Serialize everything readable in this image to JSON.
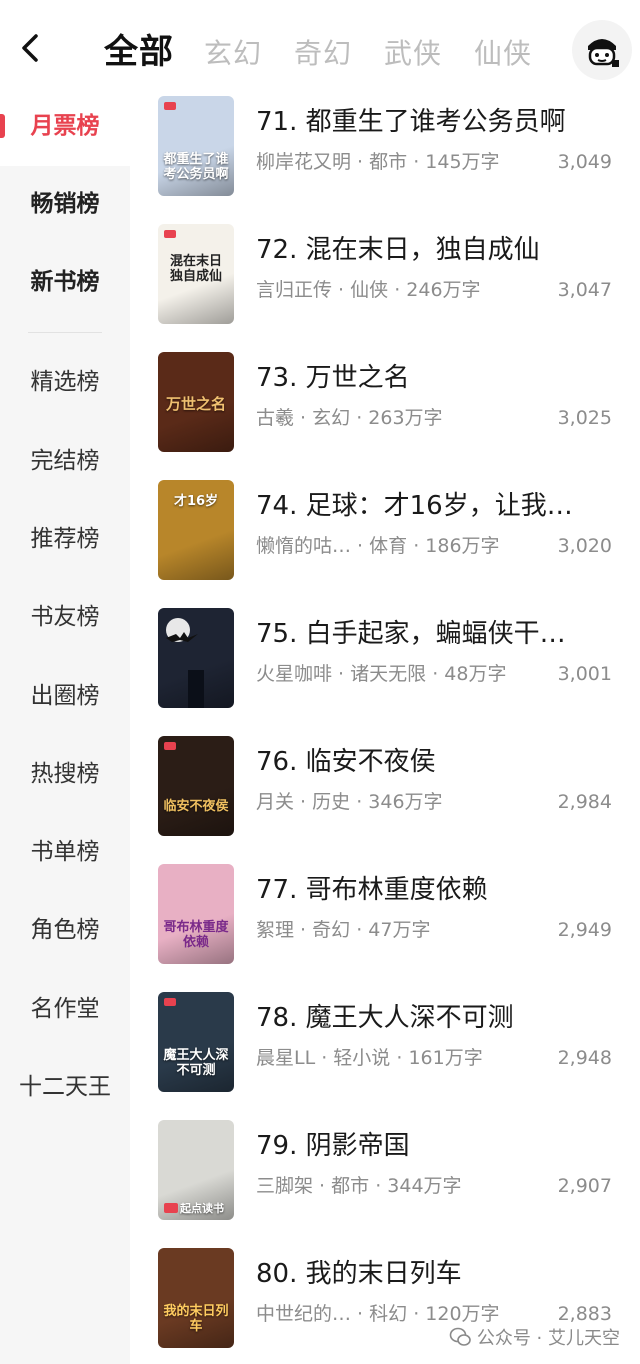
{
  "header": {
    "tabs": [
      {
        "label": "全部",
        "active": true
      },
      {
        "label": "玄幻"
      },
      {
        "label": "奇幻"
      },
      {
        "label": "武侠"
      },
      {
        "label": "仙侠"
      }
    ],
    "back_icon": "chevron-left-icon",
    "avatar_icon": "mascot-avatar-icon"
  },
  "sidebar": {
    "items": [
      {
        "label": "月票榜",
        "active": true
      },
      {
        "label": "畅销榜"
      },
      {
        "label": "新书榜"
      },
      {
        "label": "精选榜"
      },
      {
        "label": "完结榜"
      },
      {
        "label": "推荐榜"
      },
      {
        "label": "书友榜"
      },
      {
        "label": "出圈榜"
      },
      {
        "label": "热搜榜"
      },
      {
        "label": "书单榜"
      },
      {
        "label": "角色榜"
      },
      {
        "label": "名作堂"
      },
      {
        "label": "十二天王"
      }
    ]
  },
  "books": [
    {
      "title": "71. 都重生了谁考公务员啊",
      "author": "柳岸花又明",
      "genre": "都市",
      "words": "145万字",
      "votes": "3,049",
      "cover_text": "都重生了谁考公务员啊",
      "cover_color": "#c9d6e8"
    },
    {
      "title": "72. 混在末日，独自成仙",
      "author": "言归正传",
      "genre": "仙侠",
      "words": "246万字",
      "votes": "3,047",
      "cover_text": "混在末日 独自成仙",
      "cover_color": "#f4f1ea"
    },
    {
      "title": "73. 万世之名",
      "author": "古羲",
      "genre": "玄幻",
      "words": "263万字",
      "votes": "3,025",
      "cover_text": "万世之名",
      "cover_color": "#5a2a18"
    },
    {
      "title": "74. 足球：才16岁，让我…",
      "author": "懒惰的咕…",
      "genre": "体育",
      "words": "186万字",
      "votes": "3,020",
      "cover_text": "才16岁",
      "cover_color": "#b8862a"
    },
    {
      "title": "75. 白手起家，蝙蝠侠干…",
      "author": "火星咖啡",
      "genre": "诸天无限",
      "words": "48万字",
      "votes": "3,001",
      "cover_text": "",
      "cover_color": "#1e2433"
    },
    {
      "title": "76. 临安不夜侯",
      "author": "月关",
      "genre": "历史",
      "words": "346万字",
      "votes": "2,984",
      "cover_text": "临安不夜侯",
      "cover_color": "#2b1d16"
    },
    {
      "title": "77. 哥布林重度依赖",
      "author": "絮理",
      "genre": "奇幻",
      "words": "47万字",
      "votes": "2,949",
      "cover_text": "哥布林重度依赖",
      "cover_color": "#e8b0c4"
    },
    {
      "title": "78. 魔王大人深不可测",
      "author": "晨星LL",
      "genre": "轻小说",
      "words": "161万字",
      "votes": "2,948",
      "cover_text": "魔王大人深不可测",
      "cover_color": "#2a3a4a"
    },
    {
      "title": "79. 阴影帝国",
      "author": "三脚架",
      "genre": "都市",
      "words": "344万字",
      "votes": "2,907",
      "cover_text": "起点读书",
      "cover_color": "#d9d9d4"
    },
    {
      "title": "80. 我的末日列车",
      "author": "中世纪的…",
      "genre": "科幻",
      "words": "120万字",
      "votes": "2,883",
      "cover_text": "我的末日列车",
      "cover_color": "#6a3a22"
    }
  ],
  "watermark": {
    "text": "公众号 · 艾儿天空",
    "icon": "wechat-icon"
  },
  "colors": {
    "accent": "#e8424f",
    "sidebar_bg": "#f6f6f6",
    "muted_text": "#8c8c8c"
  }
}
